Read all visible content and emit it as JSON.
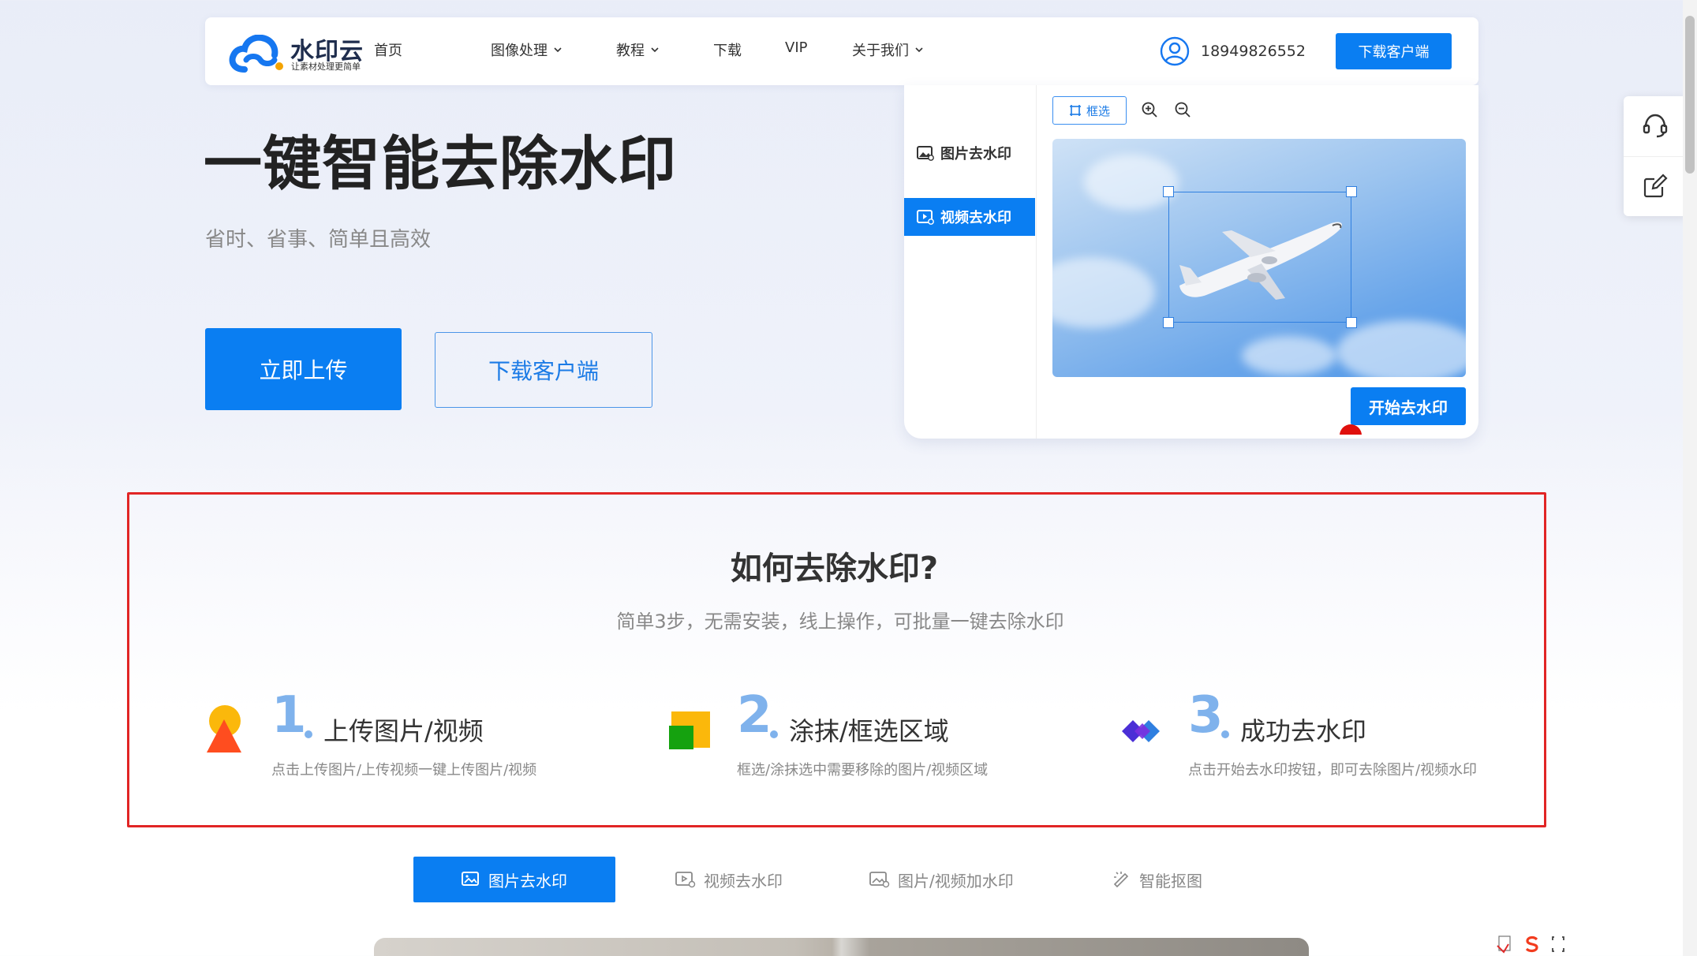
{
  "header": {
    "logo_title": "水印云",
    "logo_sub": "让素材处理更简单",
    "nav": [
      {
        "label": "首页",
        "has_menu": false
      },
      {
        "label": "图像处理",
        "has_menu": true
      },
      {
        "label": "教程",
        "has_menu": true
      },
      {
        "label": "下载",
        "has_menu": false
      },
      {
        "label": "VIP",
        "has_menu": false
      },
      {
        "label": "关于我们",
        "has_menu": true
      }
    ],
    "user_phone": "18949826552",
    "download_label": "下载客户端"
  },
  "hero": {
    "title": "一键智能去除水印",
    "subtitle": "省时、省事、简单且高效",
    "upload_label": "立即上传",
    "client_label": "下载客户端"
  },
  "demo": {
    "tabs": [
      {
        "label": "图片去水印",
        "active": false
      },
      {
        "label": "视频去水印",
        "active": true
      }
    ],
    "select_tool_label": "框选",
    "start_label": "开始去水印"
  },
  "howto": {
    "title": "如何去除水印?",
    "subtitle": "简单3步，无需安装，线上操作，可批量一键去除水印",
    "steps": [
      {
        "num": "1",
        "title": "上传图片/视频",
        "desc": "点击上传图片/上传视频一键上传图片/视频"
      },
      {
        "num": "2",
        "title": "涂抹/框选区域",
        "desc": "框选/涂抹选中需要移除的图片/视频区域"
      },
      {
        "num": "3",
        "title": "成功去水印",
        "desc": "点击开始去水印按钮，即可去除图片/视频水印"
      }
    ]
  },
  "feature_tabs": [
    {
      "label": "图片去水印",
      "active": true
    },
    {
      "label": "视频去水印",
      "active": false
    },
    {
      "label": "图片/视频加水印",
      "active": false
    },
    {
      "label": "智能抠图",
      "active": false
    }
  ],
  "colors": {
    "primary": "#0a7ef2",
    "step_number": "#7fb2ec",
    "highlight_border": "#e12525"
  }
}
